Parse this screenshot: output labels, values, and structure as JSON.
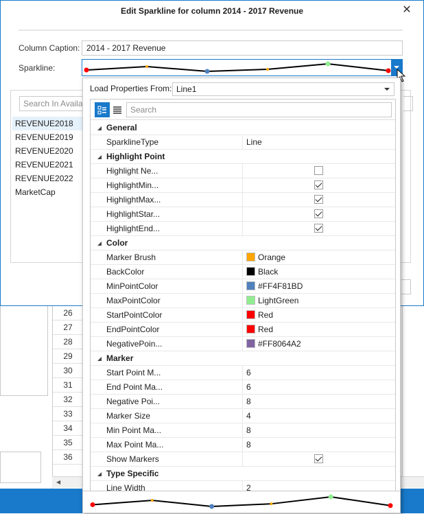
{
  "dialog": {
    "title": "Edit Sparkline for column 2014 - 2017 Revenue",
    "close_glyph": "✕",
    "column_caption_label": "Column Caption:",
    "column_caption_value": "2014 - 2017 Revenue",
    "sparkline_label": "Sparkline:",
    "search_placeholder": "Search In Available...",
    "available_columns": [
      "REVENUE2018",
      "REVENUE2019",
      "REVENUE2020",
      "REVENUE2021",
      "REVENUE2022",
      "MarketCap"
    ]
  },
  "sparkline_preview": {
    "values": [
      3,
      8,
      1,
      4,
      12,
      2
    ],
    "point_colors": [
      "#FF0000",
      "#FFA500",
      "#4F81BD",
      "#FFA500",
      "#90EE90",
      "#FF0000"
    ],
    "line_color": "#000000"
  },
  "popup": {
    "load_label": "Load Properties From:",
    "load_value": "Line1",
    "search_placeholder": "Search",
    "categories": [
      {
        "name": "General",
        "props": [
          {
            "name": "SparklineType",
            "type": "text",
            "value": "Line"
          }
        ]
      },
      {
        "name": "Highlight Point",
        "props": [
          {
            "name": "Highlight Ne...",
            "type": "checkbox",
            "checked": false
          },
          {
            "name": "HighlightMin...",
            "type": "checkbox",
            "checked": true
          },
          {
            "name": "HighlightMax...",
            "type": "checkbox",
            "checked": true
          },
          {
            "name": "HighlightStar...",
            "type": "checkbox",
            "checked": true
          },
          {
            "name": "HighlightEnd...",
            "type": "checkbox",
            "checked": true
          }
        ]
      },
      {
        "name": "Color",
        "props": [
          {
            "name": "Marker Brush",
            "type": "color",
            "value": "Orange",
            "color": "#FFA500"
          },
          {
            "name": "BackColor",
            "type": "color",
            "value": "Black",
            "color": "#000000"
          },
          {
            "name": "MinPointColor",
            "type": "color",
            "value": "#FF4F81BD",
            "color": "#4F81BD"
          },
          {
            "name": "MaxPointColor",
            "type": "color",
            "value": "LightGreen",
            "color": "#90EE90"
          },
          {
            "name": "StartPointColor",
            "type": "color",
            "value": "Red",
            "color": "#FF0000"
          },
          {
            "name": "EndPointColor",
            "type": "color",
            "value": "Red",
            "color": "#FF0000"
          },
          {
            "name": "NegativePoin...",
            "type": "color",
            "value": "#FF8064A2",
            "color": "#8064A2"
          }
        ]
      },
      {
        "name": "Marker",
        "props": [
          {
            "name": "Start Point M...",
            "type": "text",
            "value": "6"
          },
          {
            "name": "End Point Ma...",
            "type": "text",
            "value": "6"
          },
          {
            "name": "Negative Poi...",
            "type": "text",
            "value": "8"
          },
          {
            "name": "Marker Size",
            "type": "text",
            "value": "4"
          },
          {
            "name": "Min Point Ma...",
            "type": "text",
            "value": "8"
          },
          {
            "name": "Max Point Ma...",
            "type": "text",
            "value": "8"
          },
          {
            "name": "Show Markers",
            "type": "checkbox",
            "checked": true
          }
        ]
      },
      {
        "name": "Type Specific",
        "props": [
          {
            "name": "Line Width",
            "type": "text",
            "value": "2"
          }
        ]
      }
    ]
  },
  "background": {
    "row_numbers": [
      "26",
      "27",
      "28",
      "29",
      "30",
      "31",
      "32",
      "33",
      "34",
      "35",
      "36"
    ],
    "statusbar_color": "#1979CA"
  }
}
